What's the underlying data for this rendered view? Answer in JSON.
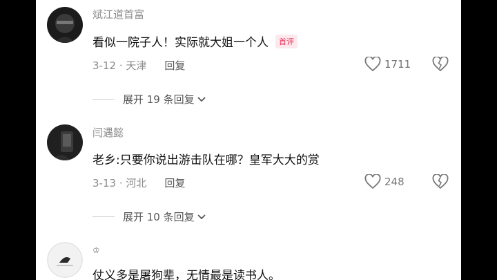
{
  "comments": [
    {
      "username": "斌江道首富",
      "text": "看似一院子人！实际就大姐一个人",
      "badge": "首评",
      "date": "3-12",
      "location": "天津",
      "reply_label": "回复",
      "likes": "1711",
      "expand_label": "展开 19 条回复"
    },
    {
      "username": "闫遇懿",
      "text": "老乡:只要你说出游击队在哪？皇军大大的赏",
      "date": "3-13",
      "location": "河北",
      "reply_label": "回复",
      "likes": "248",
      "expand_label": "展开 10 条回复"
    },
    {
      "username": "♔",
      "text": "仗义多是屠狗辈，无情最是读书人。"
    }
  ],
  "icons": {
    "like": "heart-outline-icon",
    "dislike": "broken-heart-icon",
    "expand": "chevron-down-icon"
  },
  "colors": {
    "accent_badge": "#e4325b",
    "secondary_text": "#8b8b8b"
  }
}
